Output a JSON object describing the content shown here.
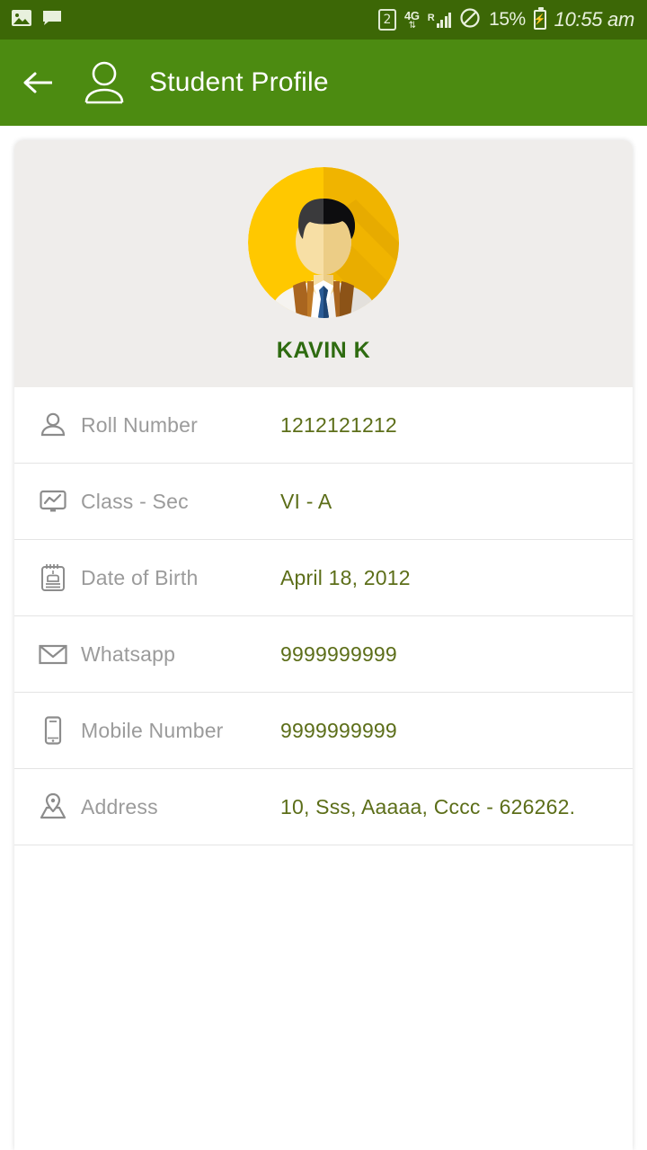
{
  "status_bar": {
    "left_icons": [
      "image-icon",
      "message-icon"
    ],
    "sim_badge": "2",
    "network_type": "4G",
    "roaming": "R",
    "dnd_icon": "do-not-disturb-icon",
    "battery_percent": "15%",
    "battery_icon": "battery-charging-icon",
    "time": "10:55 am",
    "bg_color": "#3c6706"
  },
  "app_bar": {
    "back_icon": "back-arrow-icon",
    "profile_icon": "person-outline-icon",
    "title": "Student Profile",
    "bg_color": "#4c8b11"
  },
  "profile": {
    "avatar_icon": "student-avatar",
    "name": "KAVIN K",
    "name_color": "#2e6b10",
    "header_bg": "#efedeb"
  },
  "details": {
    "label_color": "#9b9b9b",
    "value_color": "#5c6e19",
    "rows": [
      {
        "icon": "person-icon",
        "label": "Roll Number",
        "value": "1212121212"
      },
      {
        "icon": "chart-board-icon",
        "label": "Class - Sec",
        "value": "VI - A"
      },
      {
        "icon": "birthday-cake-icon",
        "label": "Date of Birth",
        "value": "April 18, 2012"
      },
      {
        "icon": "envelope-icon",
        "label": "Whatsapp",
        "value": "9999999999"
      },
      {
        "icon": "mobile-phone-icon",
        "label": "Mobile Number",
        "value": "9999999999"
      },
      {
        "icon": "map-pin-icon",
        "label": "Address",
        "value": "10, Sss, Aaaaa, Cccc - 626262."
      }
    ]
  }
}
